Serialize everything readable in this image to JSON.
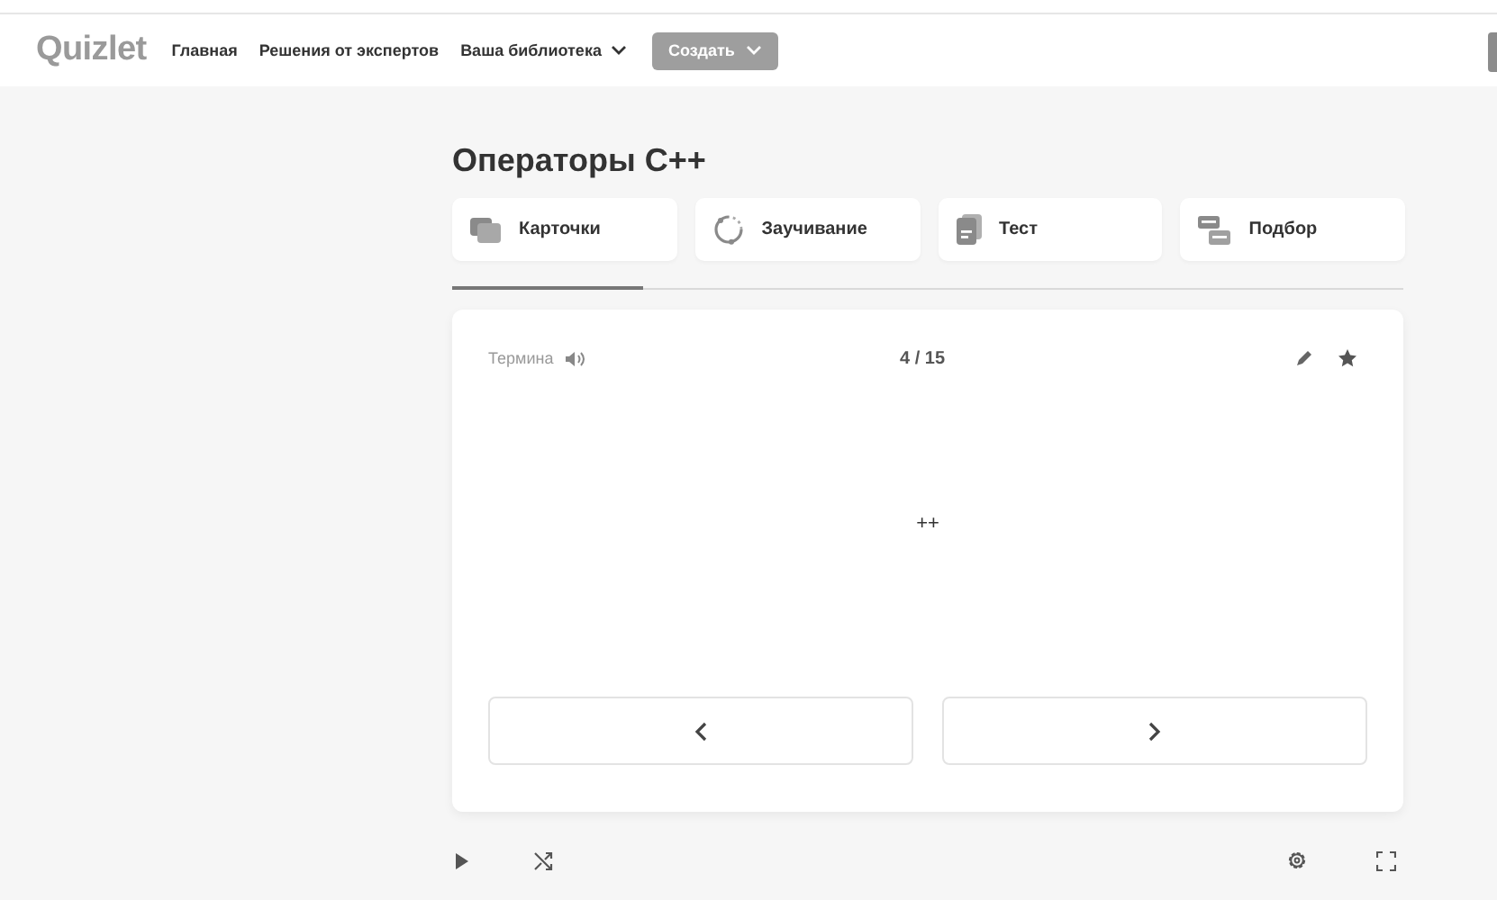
{
  "header": {
    "logo": "Quizlet",
    "nav": [
      {
        "label": "Главная",
        "dropdown": false
      },
      {
        "label": "Решения от экспертов",
        "dropdown": false
      },
      {
        "label": "Ваша библиотека",
        "dropdown": true
      }
    ],
    "create_button": {
      "label": "Создать"
    }
  },
  "title": "Операторы C++",
  "modes": [
    {
      "kind": "cards",
      "label": "Карточки"
    },
    {
      "kind": "learn",
      "label": "Заучивание"
    },
    {
      "kind": "test",
      "label": "Тест"
    },
    {
      "kind": "match",
      "label": "Подбор"
    }
  ],
  "progress": {
    "level": 0.2
  },
  "card": {
    "side_label": "Термина",
    "counter": "4 / 15",
    "term": "++"
  }
}
